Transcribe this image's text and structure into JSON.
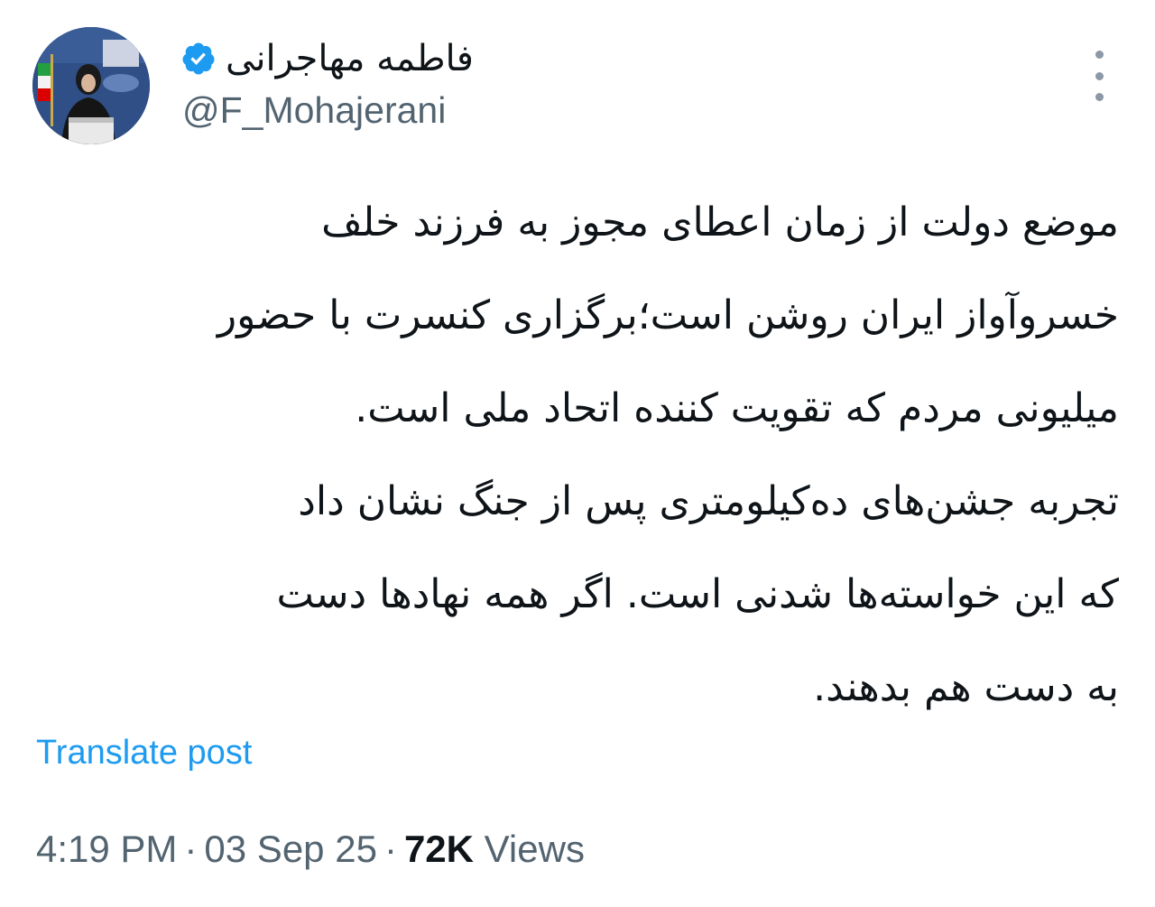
{
  "author": {
    "display_name": "فاطمه مهاجرانی",
    "handle": "@F_Mohajerani",
    "verified": true,
    "avatar_icon": "profile-photo",
    "verified_icon": "verified-badge-icon",
    "verified_color": "#1d9bf0"
  },
  "more_icon": "more-vertical-icon",
  "tweet": {
    "lines": [
      "موضع دولت از زمان اعطای مجوز به فرزند خلف",
      "خسروآواز ایران روشن است؛برگزاری کنسرت با حضور",
      "میلیونی مردم که تقویت کننده اتحاد ملی است.",
      "تجربه جشن‌های ده‌کیلومتری پس از جنگ نشان داد",
      "که این خواسته‌ها شدنی است. اگر همه نهادها دست",
      "به دست هم بدهند."
    ]
  },
  "translate_label": "Translate post",
  "meta": {
    "time": "4:19 PM",
    "separator": "·",
    "date": "03 Sep 25",
    "views_count": "72K",
    "views_label": "Views"
  },
  "colors": {
    "link": "#1d9bf0",
    "secondary_text": "#536471",
    "primary_text": "#0f1419"
  }
}
